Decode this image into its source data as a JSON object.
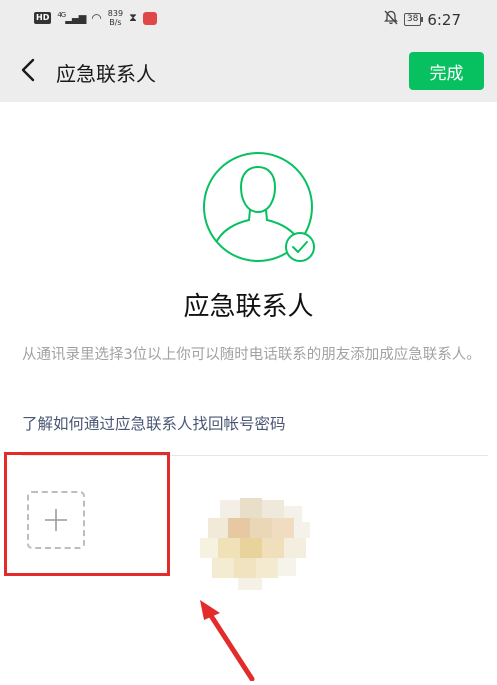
{
  "status_bar": {
    "network_badge": "HD",
    "network_type": "4G",
    "speed_value": "839",
    "speed_unit": "B/s",
    "battery": "38",
    "time": "6:27"
  },
  "navbar": {
    "title": "应急联系人",
    "done_label": "完成",
    "accent_color": "#07c160"
  },
  "main": {
    "title": "应急联系人",
    "description": "从通讯录里选择3位以上你可以随时电话联系的朋友添加成应急联系人。",
    "help_link": "了解如何通过应急联系人找回帐号密码"
  },
  "icons": [
    "back-icon",
    "user-check-icon",
    "plus-icon"
  ],
  "annotation_color": "#e32b2b"
}
